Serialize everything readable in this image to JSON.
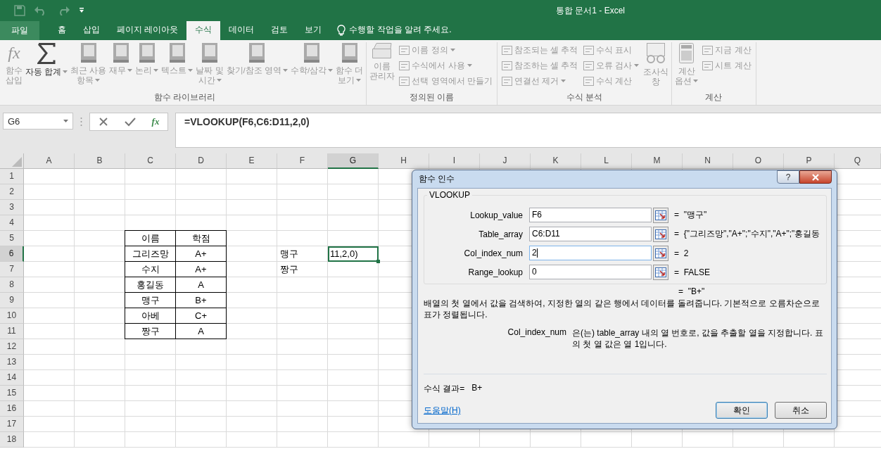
{
  "window": {
    "title": "통합 문서1 - Excel"
  },
  "file_tab": "파일",
  "tabs": [
    {
      "label": "홈",
      "selected": false
    },
    {
      "label": "삽입",
      "selected": false
    },
    {
      "label": "페이지 레이아웃",
      "selected": false
    },
    {
      "label": "수식",
      "selected": true
    },
    {
      "label": "데이터",
      "selected": false
    },
    {
      "label": "검토",
      "selected": false
    },
    {
      "label": "보기",
      "selected": false
    }
  ],
  "tell_me": "수행할 작업을 알려 주세요.",
  "ribbon": [
    {
      "label": "함수 라이브러리",
      "items": [
        {
          "kind": "fx",
          "icon_text": "fx",
          "lines": [
            "함수",
            "삽입"
          ],
          "dropdown": false,
          "disabled": true
        },
        {
          "kind": "sum",
          "lines": [
            "자동 합계"
          ],
          "dropdown": true,
          "disabled": false
        },
        {
          "kind": "book",
          "lines": [
            "최근 사용",
            "항목"
          ],
          "dropdown": true,
          "disabled": true
        },
        {
          "kind": "book",
          "lines": [
            "재무"
          ],
          "dropdown": true,
          "disabled": true
        },
        {
          "kind": "book",
          "lines": [
            "논리"
          ],
          "dropdown": true,
          "disabled": true
        },
        {
          "kind": "book",
          "lines": [
            "텍스트"
          ],
          "dropdown": true,
          "disabled": true
        },
        {
          "kind": "book",
          "lines": [
            "날짜 및",
            "시간"
          ],
          "dropdown": true,
          "disabled": true
        },
        {
          "kind": "book",
          "lines": [
            "찾기/참조 영역"
          ],
          "dropdown": true,
          "disabled": true
        },
        {
          "kind": "book",
          "lines": [
            "수학/삼각"
          ],
          "dropdown": true,
          "disabled": true
        },
        {
          "kind": "book",
          "lines": [
            "함수 더",
            "보기"
          ],
          "dropdown": true,
          "disabled": true
        }
      ]
    },
    {
      "label": "정의된 이름",
      "items": [
        {
          "kind": "cards",
          "lines": [
            "이름",
            "관리자"
          ],
          "dropdown": false,
          "disabled": true
        },
        {
          "kind": "small",
          "lines": [
            "이름 정의"
          ],
          "dropdown": true,
          "disabled": true
        },
        {
          "kind": "small",
          "lines": [
            "수식에서 사용"
          ],
          "dropdown": true,
          "disabled": true
        },
        {
          "kind": "small",
          "lines": [
            "선택 영역에서 만들기"
          ],
          "dropdown": false,
          "disabled": true
        }
      ]
    },
    {
      "label": "수식 분석",
      "items": [
        {
          "kind": "small",
          "lines": [
            "참조되는 셀 추적"
          ],
          "dropdown": false,
          "disabled": true
        },
        {
          "kind": "small",
          "lines": [
            "참조하는 셀 추적"
          ],
          "dropdown": false,
          "disabled": true
        },
        {
          "kind": "small",
          "lines": [
            "연결선 제거"
          ],
          "dropdown": true,
          "disabled": true
        },
        {
          "kind": "small",
          "lines": [
            "수식 표시"
          ],
          "dropdown": false,
          "disabled": true
        },
        {
          "kind": "small",
          "lines": [
            "오류 검사"
          ],
          "dropdown": true,
          "disabled": true
        },
        {
          "kind": "small",
          "lines": [
            "수식 계산"
          ],
          "dropdown": false,
          "disabled": true
        },
        {
          "kind": "glasses",
          "lines": [
            "조사식",
            "창"
          ],
          "dropdown": false,
          "disabled": true
        }
      ]
    },
    {
      "label": "계산",
      "items": [
        {
          "kind": "calculator",
          "lines": [
            "계산",
            "옵션"
          ],
          "dropdown": true,
          "disabled": true
        },
        {
          "kind": "small",
          "lines": [
            "지금 계산"
          ],
          "dropdown": false,
          "disabled": true
        },
        {
          "kind": "small",
          "lines": [
            "시트 계산"
          ],
          "dropdown": false,
          "disabled": true
        }
      ]
    }
  ],
  "formula_bar": {
    "name_box": "G6",
    "fx_button": "fx",
    "formula": "=VLOOKUP(F6,C6:D11,2,0)"
  },
  "sheet": {
    "columns": [
      {
        "label": "A",
        "selected": false
      },
      {
        "label": "B",
        "selected": false
      },
      {
        "label": "C",
        "selected": false
      },
      {
        "label": "D",
        "selected": false
      },
      {
        "label": "E",
        "selected": false
      },
      {
        "label": "F",
        "selected": false
      },
      {
        "label": "G",
        "selected": true
      },
      {
        "label": "H",
        "selected": false
      },
      {
        "label": "I",
        "selected": false
      },
      {
        "label": "J",
        "selected": false
      },
      {
        "label": "K",
        "selected": false
      },
      {
        "label": "L",
        "selected": false
      },
      {
        "label": "M",
        "selected": false
      },
      {
        "label": "N",
        "selected": false
      },
      {
        "label": "O",
        "selected": false
      },
      {
        "label": "P",
        "selected": false
      },
      {
        "label": "Q",
        "selected": false
      }
    ],
    "rows": [
      {
        "label": "1",
        "selected": false
      },
      {
        "label": "2",
        "selected": false
      },
      {
        "label": "3",
        "selected": false
      },
      {
        "label": "4",
        "selected": false
      },
      {
        "label": "5",
        "selected": false
      },
      {
        "label": "6",
        "selected": true
      },
      {
        "label": "7",
        "selected": false
      },
      {
        "label": "8",
        "selected": false
      },
      {
        "label": "9",
        "selected": false
      },
      {
        "label": "10",
        "selected": false
      },
      {
        "label": "11",
        "selected": false
      },
      {
        "label": "12",
        "selected": false
      },
      {
        "label": "13",
        "selected": false
      },
      {
        "label": "14",
        "selected": false
      },
      {
        "label": "15",
        "selected": false
      },
      {
        "label": "16",
        "selected": false
      },
      {
        "label": "17",
        "selected": false
      },
      {
        "label": "18",
        "selected": false
      }
    ],
    "table": [
      [
        "이름",
        "학점"
      ],
      [
        "그리즈망",
        "A+"
      ],
      [
        "수지",
        "A+"
      ],
      [
        "홍길동",
        "A"
      ],
      [
        "맹구",
        "B+"
      ],
      [
        "아베",
        "C+"
      ],
      [
        "짱구",
        "A"
      ]
    ],
    "names": [
      "맹구",
      "짱구"
    ],
    "active_cell_text": "11,2,0)"
  },
  "dialog": {
    "title": "함수 인수",
    "help_glyph": "?",
    "function": "VLOOKUP",
    "args": [
      {
        "label": "Lookup_value",
        "value": "F6",
        "result": "=  \"맹구\"",
        "focused": false
      },
      {
        "label": "Table_array",
        "value": "C6:D11",
        "result": "=  {\"그리즈망\",\"A+\";\"수지\",\"A+\";\"홍길동",
        "focused": false
      },
      {
        "label": "Col_index_num",
        "value": "2",
        "result": "=  2",
        "focused": true
      },
      {
        "label": "Range_lookup",
        "value": "0",
        "result": "=  FALSE",
        "focused": false
      }
    ],
    "result": "=  \"B+\"",
    "description": "배열의 첫 열에서 값을 검색하여, 지정한 열의 같은 행에서 데이터를 돌려줍니다. 기본적으로 오름차순으로 표가 정렬됩니다.",
    "arg_help_label": "Col_index_num",
    "arg_help": "은(는) table_array 내의 열 번호로, 값을 추출할 열을 지정합니다. 표의 첫 열 값은 열 1입니다.",
    "formula_result_label": "수식 결과=",
    "formula_result": "B+",
    "help_link": "도움말(H)",
    "buttons": [
      {
        "label": "확인",
        "default": true
      },
      {
        "label": "취소",
        "default": false
      }
    ]
  }
}
